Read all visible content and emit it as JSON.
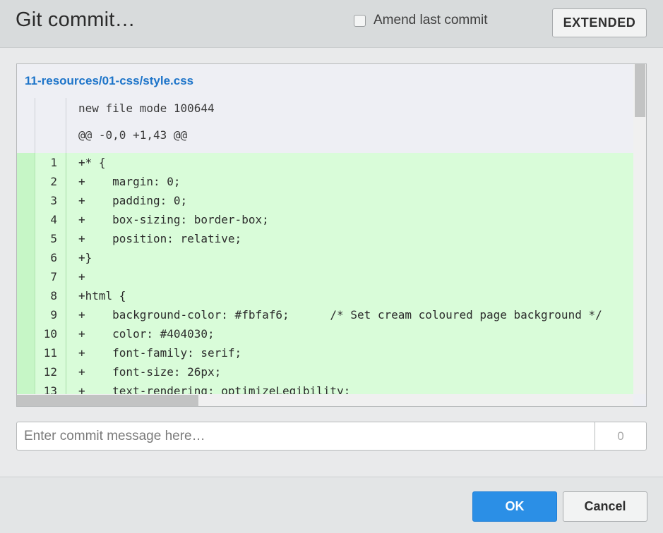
{
  "header": {
    "title": "Git commit…",
    "amend_label": "Amend last commit",
    "amend_checked": false,
    "extended_label": "EXTENDED"
  },
  "diff": {
    "file_path": "11-resources/01-css/style.css",
    "meta_lines": [
      "new file mode 100644",
      "@@ -0,0 +1,43 @@"
    ],
    "lines": [
      {
        "num": "1",
        "text": "+* {"
      },
      {
        "num": "2",
        "text": "+    margin: 0;"
      },
      {
        "num": "3",
        "text": "+    padding: 0;"
      },
      {
        "num": "4",
        "text": "+    box-sizing: border-box;"
      },
      {
        "num": "5",
        "text": "+    position: relative;"
      },
      {
        "num": "6",
        "text": "+}"
      },
      {
        "num": "7",
        "text": "+"
      },
      {
        "num": "8",
        "text": "+html {"
      },
      {
        "num": "9",
        "text": "+    background-color: #fbfaf6;      /* Set cream coloured page background */"
      },
      {
        "num": "10",
        "text": "+    color: #404030;"
      },
      {
        "num": "11",
        "text": "+    font-family: serif;"
      },
      {
        "num": "12",
        "text": "+    font-size: 26px;"
      },
      {
        "num": "13",
        "text": "+    text-rendering: optimizeLegibility;"
      }
    ]
  },
  "commit": {
    "placeholder": "Enter commit message here…",
    "value": "",
    "char_count": "0"
  },
  "footer": {
    "ok_label": "OK",
    "cancel_label": "Cancel"
  },
  "colors": {
    "added_bg": "#d9fcd9",
    "link": "#1d74c9",
    "primary_button": "#2b8fe6"
  }
}
